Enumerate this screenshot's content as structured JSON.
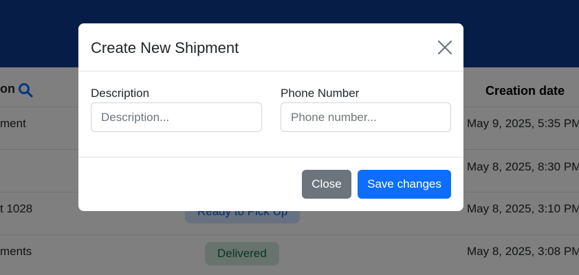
{
  "table": {
    "col_description_fragment": "on",
    "col_creation_date": "Creation date",
    "rows": [
      {
        "description": "ment",
        "status": "",
        "date": "May 9, 2025, 5:35 PM"
      },
      {
        "description": "",
        "status": "",
        "date": "May 8, 2025, 8:30 PM"
      },
      {
        "description": "t 1028",
        "status": "Ready to Pick Up",
        "date": "May 8, 2025, 3:10 PM"
      },
      {
        "description": "ments",
        "status": "Delivered",
        "date": "May 8, 2025, 3:08 PM"
      }
    ]
  },
  "modal": {
    "title": "Create New Shipment",
    "fields": {
      "description": {
        "label": "Description",
        "placeholder": "Description...",
        "value": ""
      },
      "phone": {
        "label": "Phone Number",
        "placeholder": "Phone number...",
        "value": ""
      }
    },
    "buttons": {
      "close": "Close",
      "save": "Save changes"
    }
  },
  "colors": {
    "header_bar": "#0d3b8e",
    "primary": "#0d6efd",
    "secondary": "#6c757d",
    "badge_ready_bg": "#cfe2ff",
    "badge_delivered_bg": "#d1e7dd"
  }
}
